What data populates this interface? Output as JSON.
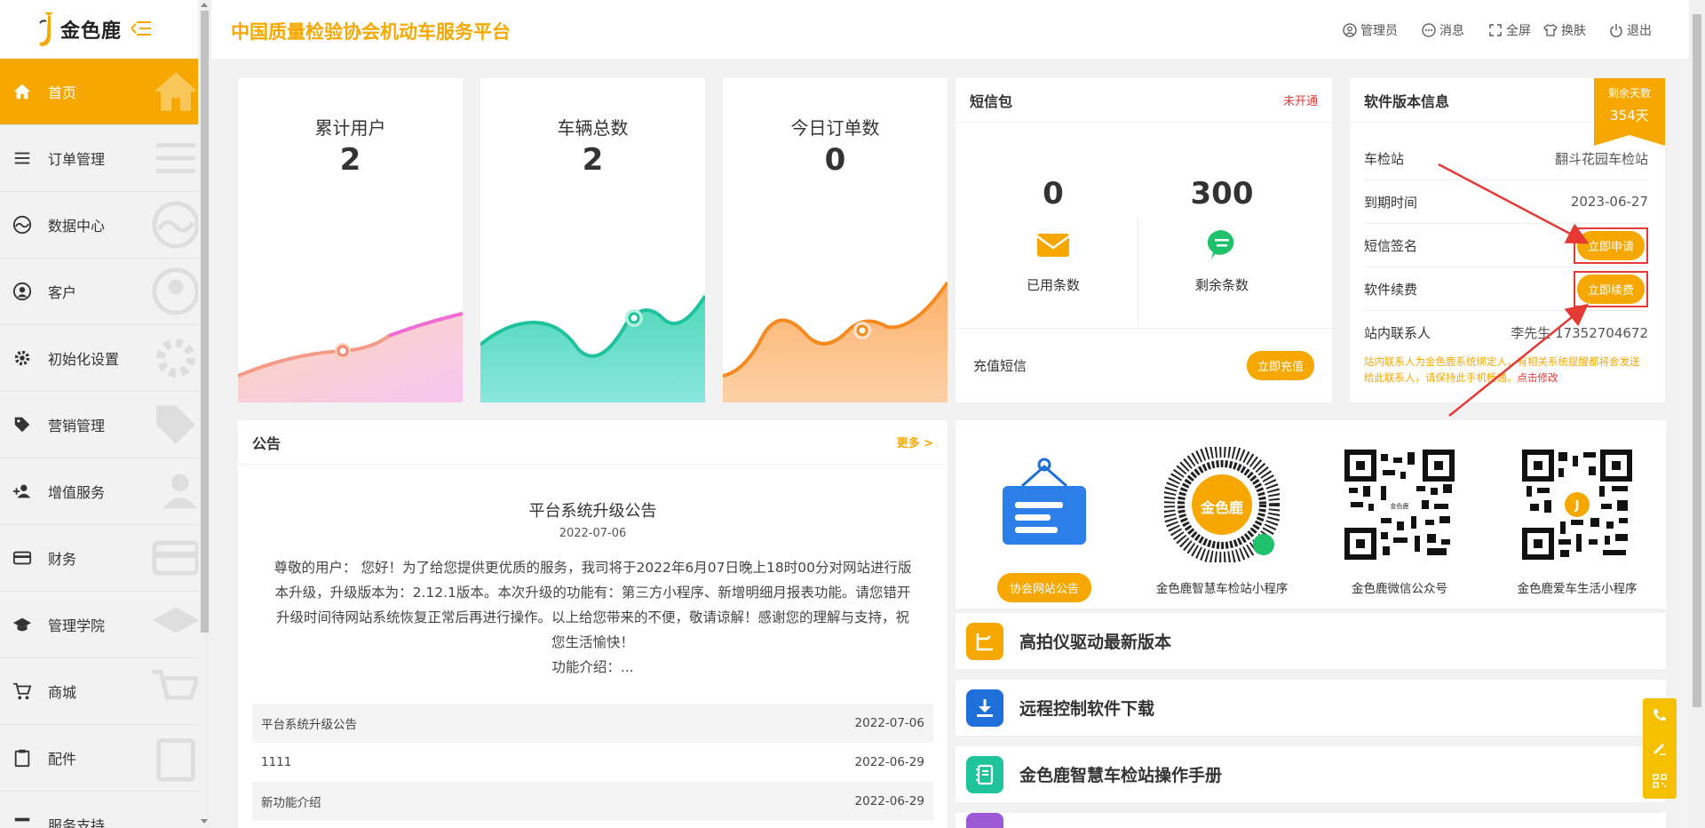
{
  "brand": {
    "name": "金色鹿"
  },
  "header": {
    "title": "中国质量检验协会机动车服务平台",
    "links": [
      {
        "label": "管理员",
        "icon": "user-icon"
      },
      {
        "label": "消息",
        "icon": "message-icon"
      },
      {
        "label": "全屏",
        "icon": "fullscreen-icon"
      },
      {
        "label": "换肤",
        "icon": "skin-icon"
      },
      {
        "label": "退出",
        "icon": "power-icon"
      }
    ]
  },
  "sidebar": {
    "items": [
      {
        "label": "首页",
        "icon": "home-icon",
        "active": true
      },
      {
        "label": "订单管理",
        "icon": "list-icon"
      },
      {
        "label": "数据中心",
        "icon": "chart-icon"
      },
      {
        "label": "客户",
        "icon": "user-icon"
      },
      {
        "label": "初始化设置",
        "icon": "gear-icon"
      },
      {
        "label": "营销管理",
        "icon": "tag-icon"
      },
      {
        "label": "增值服务",
        "icon": "add-user-icon"
      },
      {
        "label": "财务",
        "icon": "card-icon"
      },
      {
        "label": "管理学院",
        "icon": "graduation-cap-icon"
      },
      {
        "label": "商城",
        "icon": "cart-icon"
      },
      {
        "label": "配件",
        "icon": "clipboard-icon"
      },
      {
        "label": "服务支持",
        "icon": "support-icon"
      }
    ]
  },
  "stats": [
    {
      "label": "累计用户",
      "value": "2"
    },
    {
      "label": "车辆总数",
      "value": "2"
    },
    {
      "label": "今日订单数",
      "value": "0"
    }
  ],
  "sms": {
    "title": "短信包",
    "status": "未开通",
    "used_value": "0",
    "used_label": "已用条数",
    "remain_value": "300",
    "remain_label": "剩余条数",
    "recharge_label": "充值短信",
    "recharge_button": "立即充值"
  },
  "version": {
    "title": "软件版本信息",
    "badge_label": "剩余天数",
    "badge_value": "354天",
    "station_key": "车检站",
    "station_value": "翻斗花园车检站",
    "expire_key": "到期时间",
    "expire_value": "2023-06-27",
    "sign_key": "短信签名",
    "sign_button": "立即申请",
    "renew_key": "软件续费",
    "renew_button": "立即续费",
    "contact_key": "站内联系人",
    "contact_value": "李先生 17352704672",
    "note": "站内联系人为金色鹿系统绑定人，有相关系统提醒都将会发送给此联系人，请保持此手机畅通。",
    "note_link": "点击修改"
  },
  "notice": {
    "title": "公告",
    "more": "更多 >",
    "headline": "平台系统升级公告",
    "date": "2022-07-06",
    "body": "尊敬的用户： 您好！为了给您提供更优质的服务，我司将于2022年6月07日晚上18时00分对网站进行版本升级，升级版本为：2.12.1版本。本次升级的功能有：第三方小程序、新增明细月报表功能。请您错开升级时间待网站系统恢复正常后再进行操作。以上给您带来的不便，敬请谅解！感谢您的理解与支持，祝您生活愉快！",
    "intro": "功能介绍：...",
    "rows": [
      {
        "title": "平台系统升级公告",
        "date": "2022-07-06"
      },
      {
        "title": "1111",
        "date": "2022-06-29"
      },
      {
        "title": "新功能介绍",
        "date": "2022-06-29"
      }
    ]
  },
  "apps": {
    "notice_button": "协会网站公告",
    "items": [
      {
        "caption": "金色鹿智慧车检站小程序"
      },
      {
        "caption": "金色鹿微信公众号"
      },
      {
        "caption": "金色鹿爱车生活小程序"
      }
    ]
  },
  "links": [
    {
      "label": "高拍仪驱动最新版本",
      "icon": "camera-icon",
      "color": "#f6a800"
    },
    {
      "label": "远程控制软件下载",
      "icon": "download-icon",
      "color": "#1e6fd9"
    },
    {
      "label": "金色鹿智慧车检站操作手册",
      "icon": "book-icon",
      "color": "#1fc49a"
    }
  ],
  "colors": {
    "accent": "#f6a800",
    "danger": "#e53935"
  }
}
